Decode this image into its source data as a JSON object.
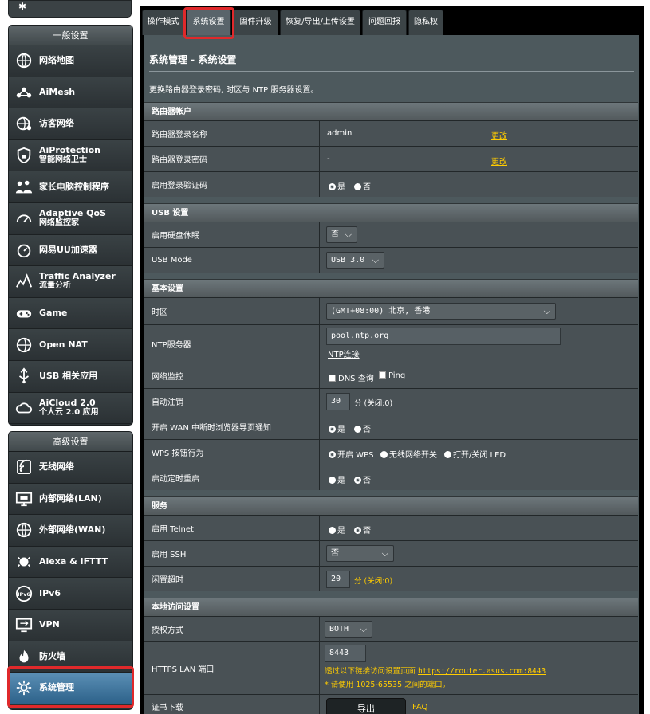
{
  "sidebar": {
    "general_header": "一般设置",
    "general_items": [
      {
        "label": "网络地图",
        "icon": "globe-network-icon"
      },
      {
        "label": "AiMesh",
        "icon": "mesh-icon"
      },
      {
        "label": "访客网络",
        "icon": "guest-globe-icon"
      },
      {
        "label": "AiProtection",
        "label2": "智能网络卫士",
        "icon": "shield-lock-icon"
      },
      {
        "label": "家长电脑控制程序",
        "icon": "family-icon"
      },
      {
        "label": "Adaptive QoS",
        "label2": "网络监控家",
        "icon": "speedometer-icon"
      },
      {
        "label": "网易UU加速器",
        "icon": "uu-gauge-icon"
      },
      {
        "label": "Traffic Analyzer",
        "label2": "流量分析",
        "icon": "traffic-chart-icon"
      },
      {
        "label": "Game",
        "icon": "gamepad-icon"
      },
      {
        "label": "Open NAT",
        "icon": "open-nat-globe-icon"
      },
      {
        "label": "USB 相关应用",
        "icon": "usb-icon"
      },
      {
        "label": "AiCloud 2.0",
        "label2": "个人云 2.0 应用",
        "icon": "cloud-icon"
      }
    ],
    "advanced_header": "高级设置",
    "advanced_items": [
      {
        "label": "无线网络",
        "icon": "wireless-icon"
      },
      {
        "label": "内部网络(LAN)",
        "icon": "lan-monitor-icon"
      },
      {
        "label": "外部网络(WAN)",
        "icon": "wan-globe-icon"
      },
      {
        "label": "Alexa & IFTTT",
        "icon": "alexa-icon"
      },
      {
        "label": "IPv6",
        "icon": "ipv6-icon"
      },
      {
        "label": "VPN",
        "icon": "vpn-icon"
      },
      {
        "label": "防火墙",
        "icon": "firewall-icon"
      },
      {
        "label": "系统管理",
        "icon": "admin-gear-icon"
      }
    ]
  },
  "tabs": [
    "操作模式",
    "系统设置",
    "固件升级",
    "恢复/导出/上传设置",
    "问题回报",
    "隐私权"
  ],
  "page": {
    "title": "系统管理 - 系统设置",
    "description": "更换路由器登录密码, 时区与 NTP 服务器设置。"
  },
  "account": {
    "header": "路由器帐户",
    "name_label": "路由器登录名称",
    "name_value": "admin",
    "name_change": "更改",
    "pwd_label": "路由器登录密码",
    "pwd_value": "-",
    "pwd_change": "更改",
    "captcha_label": "启用登录验证码",
    "yes": "是",
    "no": "否"
  },
  "usb": {
    "header": "USB 设置",
    "hdd_label": "启用硬盘休眠",
    "hdd_value": "否",
    "mode_label": "USB Mode",
    "mode_value": "USB 3.0"
  },
  "basic": {
    "header": "基本设置",
    "tz_label": "时区",
    "tz_value": "(GMT+08:00) 北京, 香港",
    "ntp_label": "NTP服务器",
    "ntp_value": "pool.ntp.org",
    "ntp_link": "NTP连接",
    "netmon_label": "网络监控",
    "dns_query": "DNS 查询",
    "ping": "Ping",
    "logout_label": "自动注销",
    "logout_value": "30",
    "logout_hint": "分 (关闭:0)",
    "wan_label": "开启 WAN 中断时浏览器导页通知",
    "yes": "是",
    "no": "否",
    "wps_label": "WPS 按钮行为",
    "wps_opt1": "开启 WPS",
    "wps_opt2": "无线网络开关",
    "wps_opt3": "打开/关闭 LED",
    "reboot_label": "启动定时重启"
  },
  "service": {
    "header": "服务",
    "telnet_label": "启用 Telnet",
    "ssh_label": "启用 SSH",
    "ssh_value": "否",
    "idle_label": "闲置超时",
    "idle_value": "20",
    "idle_hint": "分 (关闭:0)",
    "yes": "是",
    "no": "否"
  },
  "local": {
    "header": "本地访问设置",
    "auth_label": "授权方式",
    "auth_value": "BOTH",
    "https_label": "HTTPS LAN 端口",
    "https_value": "8443",
    "https_hint1_prefix": "透过以下链接访问设置页面",
    "https_hint1_url": "https://router.asus.com:8443",
    "https_hint2": "* 请使用 1025-65535 之间的端口。",
    "cert_label": "证书下载",
    "export_btn": "导出",
    "faq": "FAQ"
  },
  "colors": {
    "highlight": "#e0292b",
    "link": "#ffcc00"
  }
}
